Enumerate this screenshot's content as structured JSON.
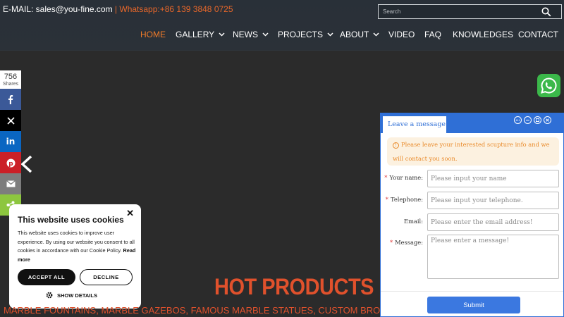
{
  "header": {
    "email": "E-MAIL: sales@you-fine.com",
    "separator": " | ",
    "whatsapp": "Whatsapp:+86 139 3848 0725",
    "search_placeholder": "Search"
  },
  "nav": {
    "items": [
      {
        "label": "HOME",
        "active": true
      },
      {
        "label": "GALLERY",
        "dropdown": true
      },
      {
        "label": "NEWS",
        "dropdown": true
      },
      {
        "label": "PROJECTS",
        "dropdown": true
      },
      {
        "label": "ABOUT",
        "dropdown": true
      },
      {
        "label": "VIDEO"
      },
      {
        "label": "FAQ"
      },
      {
        "label": "KNOWLEDGES"
      },
      {
        "label": "CONTACT"
      }
    ]
  },
  "share": {
    "count": "756",
    "count_label": "Shares",
    "buttons": [
      {
        "name": "facebook",
        "color": "#3b5998"
      },
      {
        "name": "x",
        "color": "#000000"
      },
      {
        "name": "linkedin",
        "color": "#0a66c2"
      },
      {
        "name": "pinterest",
        "color": "#cb2027"
      },
      {
        "name": "email",
        "color": "#7d7d7d"
      },
      {
        "name": "share",
        "color": "#8dc63f"
      }
    ]
  },
  "cookie": {
    "title": "This website uses cookies",
    "body": "This website uses cookies to improve user experience. By using our website you consent to all cookies in accordance with our Cookie Policy.",
    "read_more": "Read more",
    "accept": "ACCEPT ALL",
    "decline": "DECLINE",
    "show_details": "SHOW DETAILS"
  },
  "hot": {
    "title": "HOT PRODUCTS",
    "subtitle": "MARBLE FOUNTAINS, MARBLE GAZEBOS, FAMOUS MARBLE STATUES, CUSTOM BRONZE"
  },
  "message": {
    "tab": "Leave a message",
    "notice": "Please leave your interested scupture info and we will contact you soon.",
    "fields": {
      "name": {
        "label": "Your name:",
        "placeholder": "Please input your name"
      },
      "telephone": {
        "label": "Telephone:",
        "placeholder": "Please input your telephone."
      },
      "email": {
        "label": "Email:",
        "placeholder": "Please enter the email address!"
      },
      "message": {
        "label": "Message:",
        "placeholder": "Please enter a message!"
      }
    },
    "submit": "Submit"
  },
  "colors": {
    "accent_orange": "#f07b29",
    "hot_red": "#e0512c",
    "panel_blue": "#2f6fd6",
    "whatsapp_green": "#3bb84a"
  }
}
